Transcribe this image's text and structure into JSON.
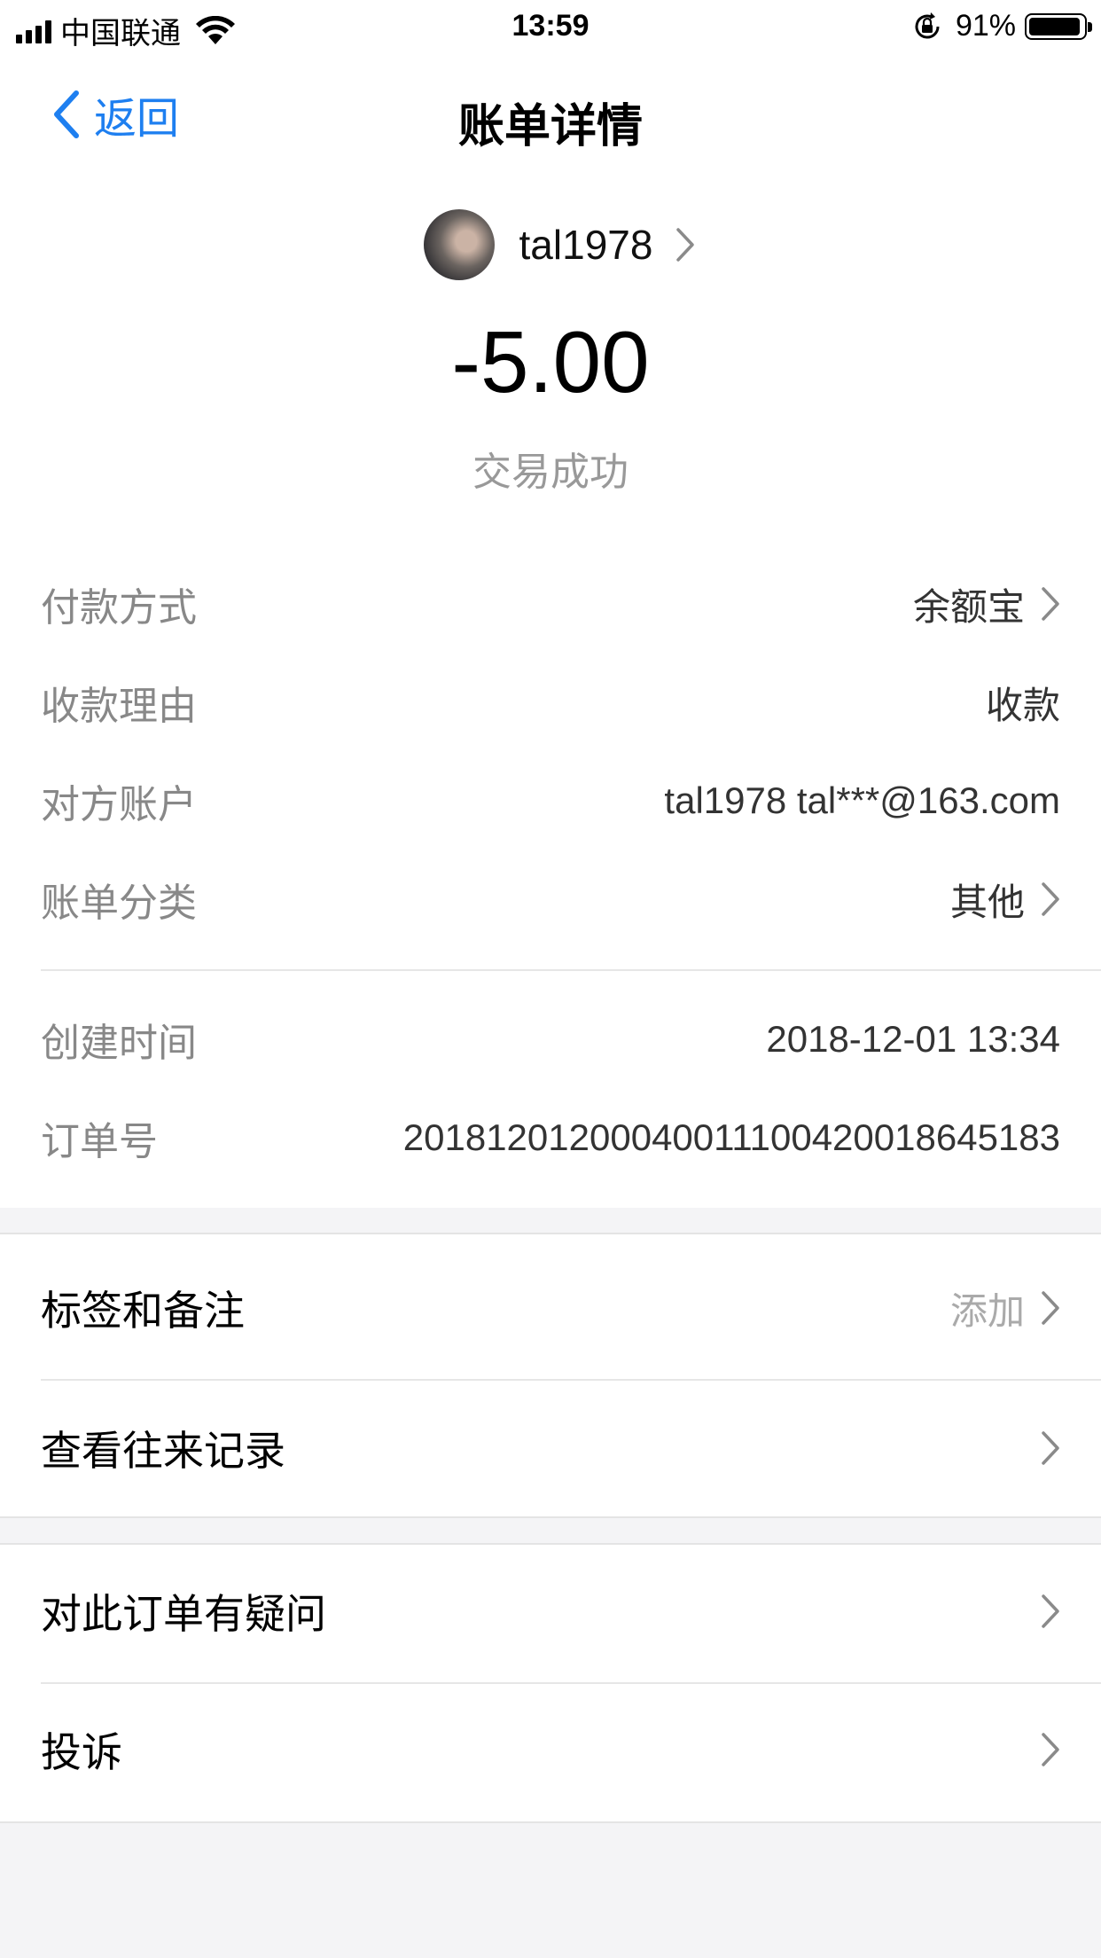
{
  "status_bar": {
    "carrier": "中国联通",
    "time": "13:59",
    "battery": "91%"
  },
  "nav": {
    "back_label": "返回",
    "title": "账单详情"
  },
  "summary": {
    "payee": "tal1978",
    "amount": "-5.00",
    "status": "交易成功"
  },
  "details": [
    {
      "key": "付款方式",
      "value": "余额宝"
    },
    {
      "key": "收款理由",
      "value": "收款"
    },
    {
      "key": "对方账户",
      "value": "tal1978 tal***@163.com"
    },
    {
      "key": "账单分类",
      "value": "其他"
    },
    {
      "key": "创建时间",
      "value": "2018-12-01 13:34"
    },
    {
      "key": "订单号",
      "value": "20181201200040011100420018645183"
    }
  ],
  "actions": {
    "tags_notes": {
      "label": "标签和备注",
      "hint": "添加"
    },
    "history": {
      "label": "查看往来记录"
    },
    "question": {
      "label": "对此订单有疑问"
    },
    "complaint": {
      "label": "投诉"
    }
  },
  "colors": {
    "accent": "#1e7ff0",
    "page_background": "#f4f4f6",
    "key_text": "#888888"
  }
}
